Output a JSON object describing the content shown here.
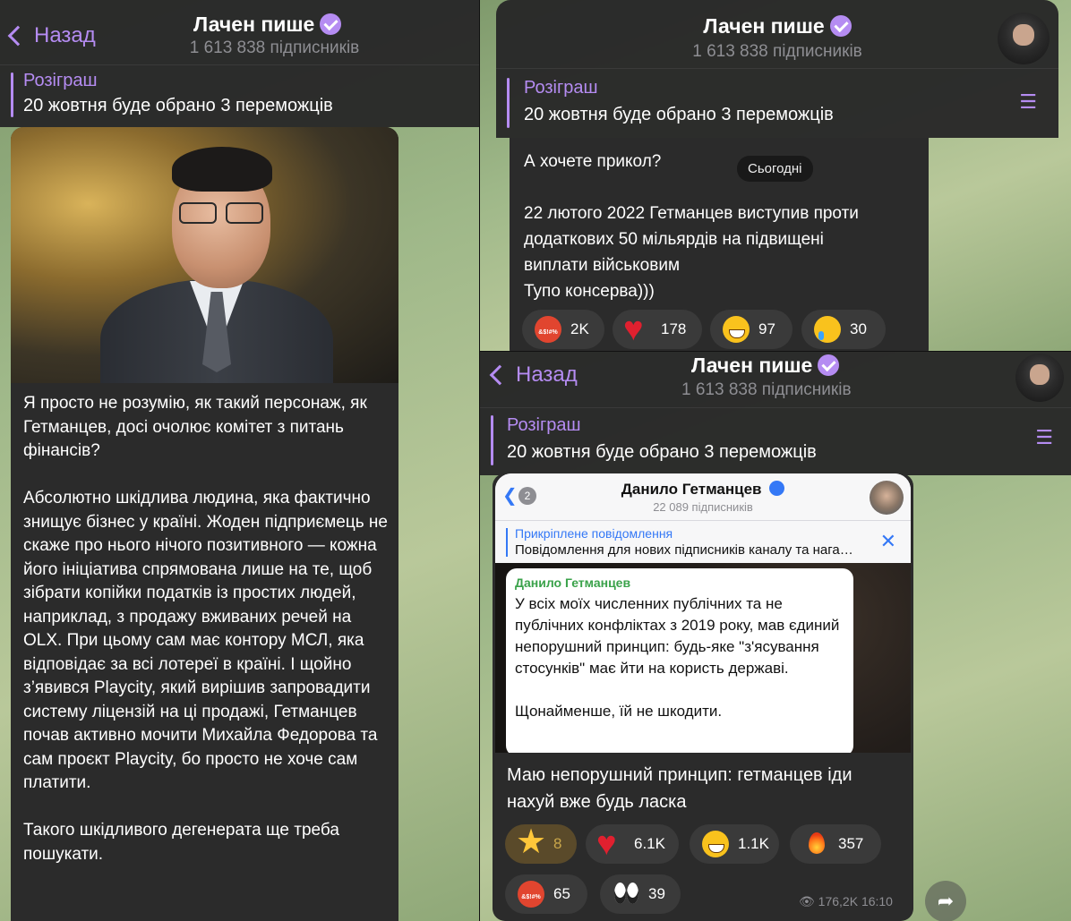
{
  "channel": {
    "name": "Лачен пише",
    "subscribers": "1 613 838 підписників",
    "back_label": "Назад"
  },
  "pinned": {
    "heading": "Розіграш",
    "text": "20 жовтня буде обрано 3 переможців"
  },
  "left_post": {
    "text": "Я просто не розумію, як такий персонаж, як Гетманцев, досі очолює комітет з питань фінансів?\n\nАбсолютно шкідлива людина, яка фактично знищує бізнес у країні. Жоден підприємець не скаже про нього нічого позитивного — кожна його ініціатива спрямована лише на те, щоб зібрати копійки податків із простих людей, наприклад, з продажу вживаних речей на OLX. При цьому сам має контору МСЛ, яка відповідає за всі лотереї в країні. І щойно з’явився Playcity, який вирішив запровадити систему ліцензій на ці продажі, Гетманцев почав активно мочити Михайла Федорова та сам проєкт Playcity, бо просто не хоче сам платити.\n\nТакого шкідливого дегенерата ще треба пошукати."
  },
  "top_right_post": {
    "date_badge": "Сьогодні",
    "text": "А хочете прикол?\n\n22 лютого 2022 Гетманцев виступив проти додаткових 50 мільярдів на підвищені виплати військовим\nТупо консерва)))",
    "reactions": [
      {
        "icon": "angry-swearing-emoji",
        "count": "2K"
      },
      {
        "icon": "red-heart-emoji",
        "count": "178"
      },
      {
        "icon": "grinning-emoji",
        "count": "97"
      },
      {
        "icon": "crying-emoji",
        "count": "30"
      }
    ]
  },
  "bottom_right_post": {
    "screenshot": {
      "back_count": "2",
      "channel_name": "Данило Гетманцев",
      "subscribers": "22 089 підписників",
      "pinned_heading": "Прикріплене повідомлення",
      "pinned_text": "Повідомлення для нових підписників каналу та нага…",
      "author": "Данило Гетманцев",
      "message": "У всіх моїх численних публічних та не публічних конфліктах з 2019 року, мав єдиний непорушний принцип:  будь-яке \"з'ясування стосунків\" має йти на користь державі.\n\nЩонайменше, їй не шкодити."
    },
    "text": "Маю непорушний принцип: гетманцев іди нахуй вже будь ласка",
    "reactions": [
      {
        "icon": "star-struck-emoji",
        "count": "8"
      },
      {
        "icon": "red-heart-emoji",
        "count": "6.1K"
      },
      {
        "icon": "grinning-emoji",
        "count": "1.1K"
      },
      {
        "icon": "fire-emoji",
        "count": "357"
      },
      {
        "icon": "angry-swearing-emoji",
        "count": "65"
      },
      {
        "icon": "eyes-emoji",
        "count": "39"
      }
    ],
    "views": "176,2K",
    "time": "16:10"
  },
  "colors": {
    "accent": "#b58cf2",
    "bubble": "#2b2b2b",
    "header": "#282828"
  }
}
